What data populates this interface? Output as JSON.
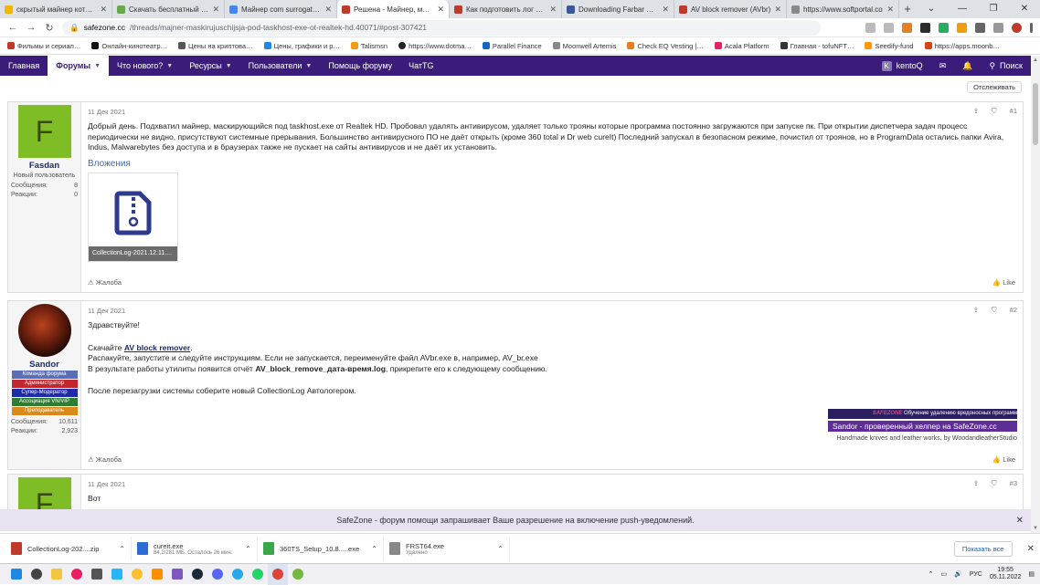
{
  "tabs": [
    {
      "title": "скрытый майнер которые",
      "color": "#f4b400",
      "active": false
    },
    {
      "title": "Скачать бесплатный анти",
      "color": "#6aa84f",
      "active": false
    },
    {
      "title": "Майнер com surrogate/m",
      "color": "#4285f4",
      "active": false
    },
    {
      "title": "Решена - Майнер, маски",
      "color": "#c0392b",
      "active": true
    },
    {
      "title": "Как подготовить лог Farb",
      "color": "#c0392b",
      "active": false
    },
    {
      "title": "Downloading Farbar Reco",
      "color": "#3b5998",
      "active": false
    },
    {
      "title": "AV block remover (AVbr)",
      "color": "#c0392b",
      "active": false
    },
    {
      "title": "https://www.softportal.co",
      "color": "#888888",
      "active": false
    }
  ],
  "window_controls": [
    "⌄",
    "—",
    "❐",
    "✕"
  ],
  "address": {
    "host": "safezone.cc",
    "path": "/threads/majner-maskirujuschijsja-pod-taskhost-exe-ot-realtek-hd.40071/#post-307421"
  },
  "bookmarks": [
    "Фильмы и сериал…",
    "Онлайн-кинотеатр…",
    "Цены на криптова…",
    "Цены, графики и р…",
    "Talismsn",
    "https://www.dotma…",
    "Parallel Finance",
    "Moonwell Artemis",
    "Check EQ Vesting |…",
    "Acala Platform",
    "Главная - tofuNFT…",
    "Seedify-fund",
    "https://apps.moonb…"
  ],
  "nav": {
    "items": [
      "Главная",
      "Форумы",
      "Что нового?",
      "Ресурсы",
      "Пользователи",
      "Помощь форуму",
      "ЧатTG"
    ],
    "user": "kentoQ",
    "user_initial": "K",
    "search": "Поиск"
  },
  "unwatch": "Отслеживать",
  "posts": [
    {
      "date": "11 Дек 2021",
      "num": "#1",
      "author": "Fasdan",
      "initial": "F",
      "title": "Новый пользователь",
      "stat_labels": [
        "Сообщения:",
        "Реакции:"
      ],
      "stat_values": [
        "8",
        "0"
      ],
      "text": "Добрый день. Подхватил майнер, маскирующийся под taskhost.exe от Realtek HD. Пробовал удалять антивирусом, удаляет только трояны которые программа постоянно загружаются при запуске пк. При открытии диспетчера задач процесс периодически не видно, присутствуют системные прерывания. Большинство антивирусного ПО не даёт открыть (кроме 360 total и Dr web cureIt) Последний запускал в безопасном режиме, почистил от троянов, но в ProgramData остались папки Avira, Indus, Malwarebytes без доступа и в браузерах также не пускает на сайты антивирусов и не даёт их установить.",
      "attach_label": "Вложения",
      "attach_name": "CollectionLog-2021.12.11....",
      "report": "Жалоба",
      "like": "Like"
    },
    {
      "date": "11 Дек 2021",
      "num": "#2",
      "author": "Sandor",
      "title": "",
      "banners": [
        {
          "text": "Команда форума",
          "color": "#5b6fb5"
        },
        {
          "text": "Администратор",
          "color": "#c0282d"
        },
        {
          "text": "Супер-Модератор",
          "color": "#1f2aa8"
        },
        {
          "text": "Ассоциация VN/VIP",
          "color": "#2f7d32"
        },
        {
          "text": "Преподаватель",
          "color": "#d98a1a"
        }
      ],
      "stat_labels": [
        "Сообщения:",
        "Реакции:"
      ],
      "stat_values": [
        "10,611",
        "2,923"
      ],
      "greeting": "Здравствуйте!",
      "line1_pre": "Скачайте ",
      "line1_link": "AV block remover",
      "line1_post": ".",
      "line2": "Распакуйте, запустите и следуйте инструкциям. Если не запускается, переименуйте файл AVbr.exe в, например, AV_br.exe",
      "line3_pre": "В результате работы утилиты появится отчёт ",
      "line3_bold": "AV_block_remove_дата-время.log",
      "line3_post": ", прикрепите его к следующему сообщению.",
      "line4": "После перезагрузки системы соберите новый CollectionLog Автологером.",
      "sig1_logo": "SAFEZONE",
      "sig1_tail": "Обучение удалению вредоносных программ",
      "sig2": "Sandor - проверенный хелпер на SafeZone.cc",
      "sig3": "Handmade knives and leather works. by WoodandleatherStudio",
      "report": "Жалоба",
      "like": "Like"
    },
    {
      "date": "11 Дек 2021",
      "num": "#3",
      "initial": "F",
      "text": "Вот"
    }
  ],
  "push_text": "SafeZone - форум помощи запрашивает Ваше разрешение на включение push-уведомлений.",
  "downloads": [
    {
      "name": "CollectionLog-202....zip",
      "sub": "",
      "color": "#c0392b"
    },
    {
      "name": "cureit.exe",
      "sub": "84,2/281 МБ. Осталось 26 мин.",
      "color": "#2a6bd6"
    },
    {
      "name": "360TS_Setup_10.8.....exe",
      "sub": "",
      "color": "#3aa74a"
    },
    {
      "name": "FRST64.exe",
      "sub": "Удалено",
      "color": "#888888"
    }
  ],
  "show_all": "Показать все",
  "tray": {
    "lang": "РУС",
    "time": "19:55",
    "date": "05.11.2022"
  }
}
